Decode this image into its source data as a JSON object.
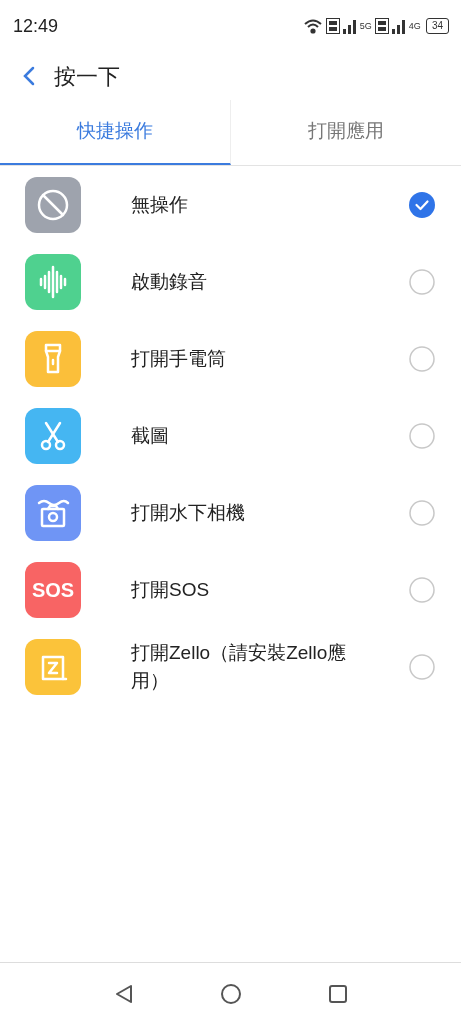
{
  "status_bar": {
    "time": "12:49",
    "sim1_network": "5G",
    "sim2_network": "4G",
    "battery": "34"
  },
  "header": {
    "title": "按一下"
  },
  "tabs": [
    {
      "label": "快捷操作",
      "selected": true
    },
    {
      "label": "打開應用",
      "selected": false
    }
  ],
  "options": [
    {
      "kind": "none",
      "label": "無操作",
      "selected": true,
      "color": "#9ea3ad"
    },
    {
      "kind": "record",
      "label": "啟動錄音",
      "selected": false,
      "color": "#4fd18f"
    },
    {
      "kind": "flashlight",
      "label": "打開手電筒",
      "selected": false,
      "color": "#fbbf3a"
    },
    {
      "kind": "screenshot",
      "label": "截圖",
      "selected": false,
      "color": "#45b6f2"
    },
    {
      "kind": "camera",
      "label": "打開水下相機",
      "selected": false,
      "color": "#6f95f5"
    },
    {
      "kind": "sos",
      "label": "打開SOS",
      "selected": false,
      "color": "#f86464",
      "icon_text": "SOS"
    },
    {
      "kind": "zello",
      "label": "打開Zello（請安裝Zello應用）",
      "selected": false,
      "color": "#fbc33a"
    }
  ]
}
